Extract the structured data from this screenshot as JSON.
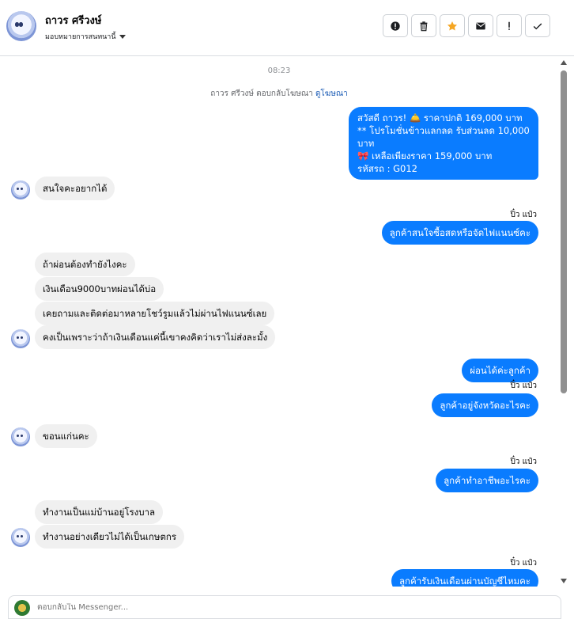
{
  "header": {
    "contact_name": "ถาวร ศรีวงษ์",
    "assign_label": "มอบหมายการสนทนานี้",
    "actions": [
      {
        "icon": "alert-circle-icon"
      },
      {
        "icon": "trash-icon"
      },
      {
        "icon": "star-icon"
      },
      {
        "icon": "mail-icon"
      },
      {
        "icon": "exclamation-icon"
      },
      {
        "icon": "check-icon"
      }
    ],
    "star_color": "#f5a623"
  },
  "thread": {
    "timestamp": "08:23",
    "reply_note": "ถาวร ศรีวงษ์ ตอบกลับโฆษณา",
    "reply_note_link": "ดูโฆษณา",
    "messages": [
      {
        "dir": "out",
        "lines": [
          "สวัสดี ถาวร! 🛎️ ราคาปกติ 169,000 บาท",
          "** โปรโมชั่นข้าวแลกลด รับส่วนลด 10,000 บาท",
          "🎀 เหลือเพียงราคา 159,000 บาท",
          " รหัสรถ : G012"
        ]
      },
      {
        "dir": "in",
        "text": "สนใจคะอยากได้"
      },
      {
        "dir": "sender",
        "text": "ปิ๋ว แป๋ว"
      },
      {
        "dir": "out",
        "text": "ลูกค้าสนใจซื้อสดหรือจัดไฟแนนซ์คะ"
      },
      {
        "dir": "in",
        "text": "ถ้าผ่อนต้องทำยังไงคะ"
      },
      {
        "dir": "in",
        "text": "เงินเดือน9000บาทผ่อนได้บ่อ"
      },
      {
        "dir": "in",
        "text": "เคยถามและติดต่อมาหลายโชว์รูมแล้วไม่ผ่านไฟแนนซ์เลย"
      },
      {
        "dir": "in",
        "text": "คงเป็นเพราะว่าถ้าเงินเดือนแค่นี้เขาคงคิดว่าเราไม่ส่งละมั้ง"
      },
      {
        "dir": "out",
        "text": "ผ่อนได้ค่ะลูกค้า"
      },
      {
        "dir": "sender",
        "text": "ปิ๋ว แป๋ว"
      },
      {
        "dir": "out",
        "text": "ลูกค้าอยู่จังหวัดอะไรคะ"
      },
      {
        "dir": "in",
        "text": "ขอนแก่นคะ"
      },
      {
        "dir": "sender",
        "text": "ปิ๋ว แป๋ว"
      },
      {
        "dir": "out",
        "text": "ลูกค้าทำอาชีพอะไรคะ"
      },
      {
        "dir": "in",
        "text": "ทำงานเป็นแม่บ้านอยู่โรงบาล"
      },
      {
        "dir": "in",
        "text": "ทำงานอย่างเดียวไม่ได้เป็นเกษตกร"
      },
      {
        "dir": "sender",
        "text": "ปิ๋ว แป๋ว"
      },
      {
        "dir": "out",
        "text": "ลูกค้ารับเงินเดือนผ่านบัญชีไหมคะ"
      }
    ],
    "outgoing_color": "#0a7cff",
    "incoming_color": "#f0f0f0"
  },
  "composer": {
    "placeholder": "ตอบกลับใน Messenger..."
  }
}
